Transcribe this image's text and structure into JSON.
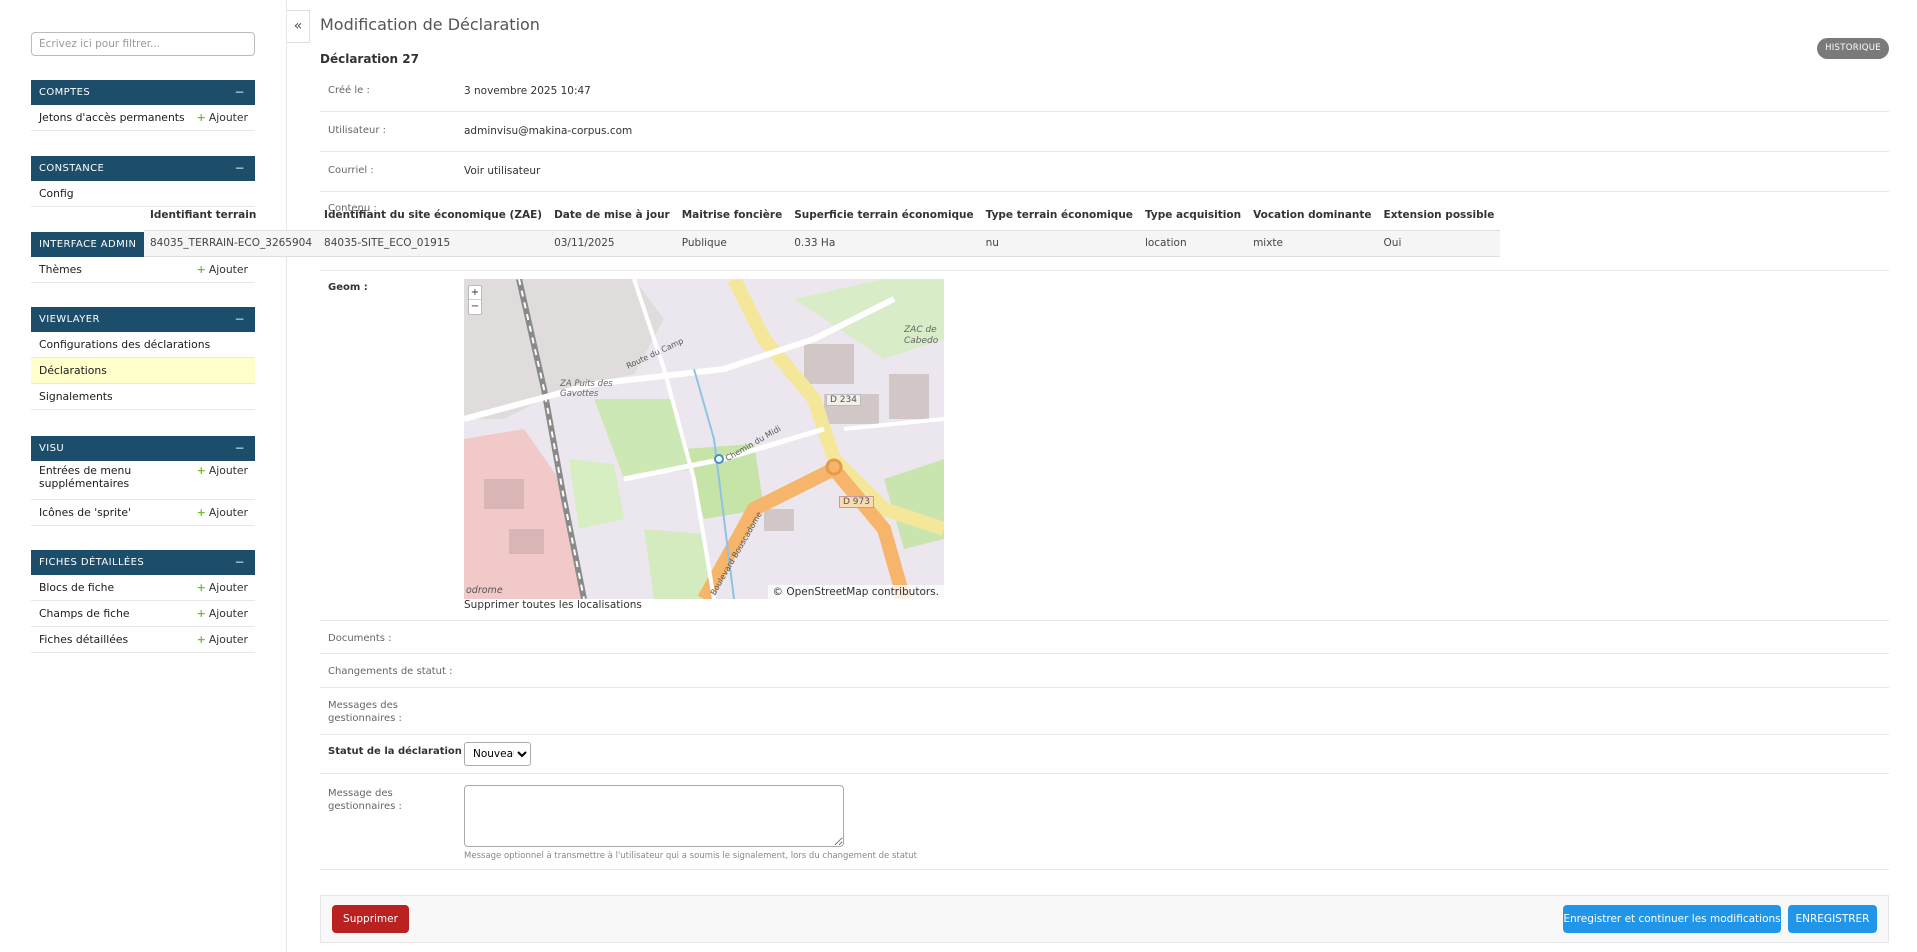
{
  "sidebar": {
    "filter_placeholder": "Écrivez ici pour filtrer...",
    "add_label": "Ajouter",
    "modules": {
      "comptes": {
        "title": "COMPTES",
        "items": [
          "Jetons d'accès permanents"
        ]
      },
      "constance": {
        "title": "CONSTANCE",
        "items": [
          "Config"
        ]
      },
      "interface_admin": {
        "title": "INTERFACE ADMIN",
        "items": [
          "Thèmes"
        ]
      },
      "viewlayer": {
        "title": "VIEWLAYER",
        "items": [
          "Configurations des déclarations",
          "Déclarations",
          "Signalements"
        ]
      },
      "visu": {
        "title": "VISU",
        "items": [
          "Entrées de menu supplémentaires",
          "Icônes de 'sprite'"
        ]
      },
      "fiches": {
        "title": "FICHES DÉTAILLÉES",
        "items": [
          "Blocs de fiche",
          "Champs de fiche",
          "Fiches détaillées"
        ]
      }
    },
    "collapse_icon": "«"
  },
  "header": {
    "title": "Modification de Déclaration",
    "object_title": "Déclaration 27",
    "history_button": "HISTORIQUE"
  },
  "fields": {
    "created_label": "Créé le :",
    "created_value": "3 novembre 2025 10:47",
    "user_label": "Utilisateur :",
    "user_value": "adminvisu@makina-corpus.com",
    "email_label": "Courriel :",
    "email_value": "Voir utilisateur",
    "content_label": "Contenu :",
    "geom_label": "Geom :",
    "remove_locations": "Supprimer toutes les localisations",
    "documents_label": "Documents :",
    "status_changes_label": "Changements de statut :",
    "manager_messages_label": "Messages des gestionnaires :",
    "status_label": "Statut de la déclaration :",
    "status_value": "Nouveau",
    "manager_message_label": "Message des gestionnaires :",
    "manager_message_help": "Message optionnel à transmettre à l'utilisateur qui a soumis le signalement, lors du changement de statut"
  },
  "content_table": {
    "headers": [
      "Identifiant terrain",
      "Identifiant du site économique (ZAE)",
      "Date de mise à jour",
      "Maitrise foncière",
      "Superficie terrain économique",
      "Type terrain économique",
      "Type acquisition",
      "Vocation dominante",
      "Extension possible"
    ],
    "row": [
      "84035_TERRAIN-ECO_3265904",
      "84035-SITE_ECO_01915",
      "03/11/2025",
      "Publique",
      "0.33 Ha",
      "nu",
      "location",
      "mixte",
      "Oui"
    ]
  },
  "map": {
    "zoom_in": "+",
    "zoom_out": "−",
    "attribution_brand": "© OpenStreetMap",
    "attribution_rest": " contributors.",
    "labels": {
      "zae": "ZAC de Cabedo",
      "zone": "ZA Puits des Gavottes",
      "route1": "D 234",
      "route2": "D 973",
      "chemin": "Chemin du Midi",
      "boulevard": "Boulevard Bouscadome",
      "route_camp": "Route du Camp",
      "aerodrome": "odrome"
    }
  },
  "actions": {
    "delete": "Supprimer",
    "save_continue": "Enregistrer et continuer les modifications",
    "save": "ENREGISTRER"
  }
}
